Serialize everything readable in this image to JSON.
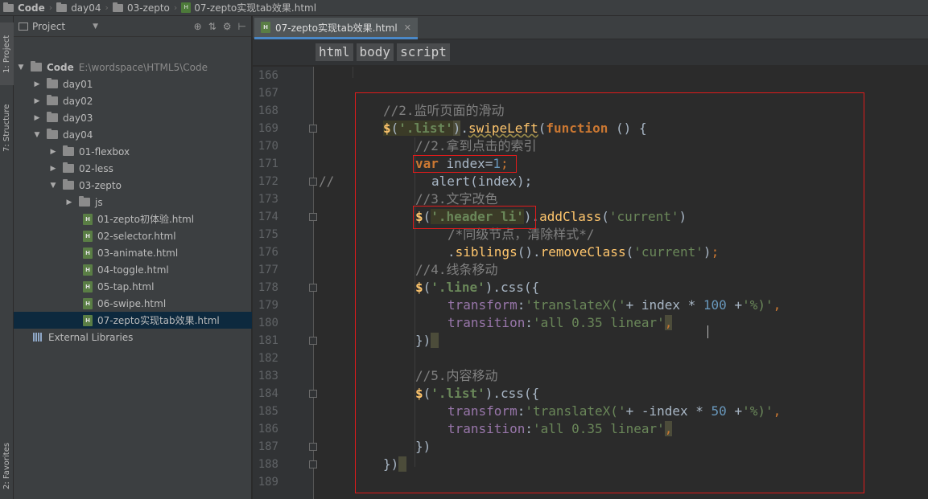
{
  "breadcrumb": [
    "Code",
    "day04",
    "03-zepto",
    "07-zepto实现tab效果.html"
  ],
  "left_strip": {
    "project_tab": "1: Project",
    "structure_tab": "7: Structure",
    "favorites_tab": "2: Favorites"
  },
  "project_panel": {
    "title": "Project",
    "tree": [
      {
        "label": "Code",
        "path": "E:\\wordspace\\HTML5\\Code",
        "type": "folder",
        "depth": 0,
        "expanded": true
      },
      {
        "label": "day01",
        "type": "folder",
        "depth": 1,
        "expanded": false
      },
      {
        "label": "day02",
        "type": "folder",
        "depth": 1,
        "expanded": false
      },
      {
        "label": "day03",
        "type": "folder",
        "depth": 1,
        "expanded": false
      },
      {
        "label": "day04",
        "type": "folder",
        "depth": 1,
        "expanded": true
      },
      {
        "label": "01-flexbox",
        "type": "folder",
        "depth": 2,
        "expanded": false
      },
      {
        "label": "02-less",
        "type": "folder",
        "depth": 2,
        "expanded": false
      },
      {
        "label": "03-zepto",
        "type": "folder",
        "depth": 2,
        "expanded": true
      },
      {
        "label": "js",
        "type": "folder",
        "depth": 3,
        "expanded": false
      },
      {
        "label": "01-zepto初体验.html",
        "type": "html",
        "depth": 3
      },
      {
        "label": "02-selector.html",
        "type": "html",
        "depth": 3
      },
      {
        "label": "03-animate.html",
        "type": "html",
        "depth": 3
      },
      {
        "label": "04-toggle.html",
        "type": "html",
        "depth": 3
      },
      {
        "label": "05-tap.html",
        "type": "html",
        "depth": 3
      },
      {
        "label": "06-swipe.html",
        "type": "html",
        "depth": 3
      },
      {
        "label": "07-zepto实现tab效果.html",
        "type": "html",
        "depth": 3,
        "selected": true
      },
      {
        "label": "External Libraries",
        "type": "lib",
        "depth": 0
      }
    ]
  },
  "editor": {
    "tab_label": "07-zepto实现tab效果.html",
    "tag_crumbs": [
      "html",
      "body",
      "script"
    ],
    "line_numbers": [
      "166",
      "167",
      "168",
      "169",
      "170",
      "171",
      "172",
      "173",
      "174",
      "175",
      "176",
      "177",
      "178",
      "179",
      "180",
      "181",
      "182",
      "183",
      "184",
      "185",
      "186",
      "187",
      "188",
      "189"
    ],
    "code": {
      "l168": "//2.监听页面的滑动",
      "l169_sel": "'.list'",
      "l169_fn": "swipeLeft",
      "l169_kw": "function",
      "l170": "//2.拿到点击的索引",
      "l171_kw": "var",
      "l171_rest": " index=",
      "l171_num": "1",
      "l172_cm": "//",
      "l172": "alert(index);",
      "l173": "//3.文字改色",
      "l174_sel": "'.header li'",
      "l174_fn": "addClass",
      "l174_arg": "'current'",
      "l175": "/*同级节点，清除样式*/",
      "l176_fn1": "siblings",
      "l176_fn2": "removeClass",
      "l176_arg": "'current'",
      "l177": "//4.线条移动",
      "l178_sel": "'.line'",
      "l178_fn": "css",
      "l179_prop": "transform",
      "l179_s1": "'translateX('",
      "l179_mid": "+ index * ",
      "l179_num": "100",
      "l179_s2": "'%)'",
      "l180_prop": "transition",
      "l180_s": "'all 0.35 linear'",
      "l183": "//5.内容移动",
      "l184_sel": "'.list'",
      "l184_fn": "css",
      "l185_prop": "transform",
      "l185_s1": "'translateX('",
      "l185_mid": "+ -index * ",
      "l185_num": "50",
      "l185_s2": "'%)'",
      "l186_prop": "transition",
      "l186_s": "'all 0.35 linear'"
    }
  }
}
